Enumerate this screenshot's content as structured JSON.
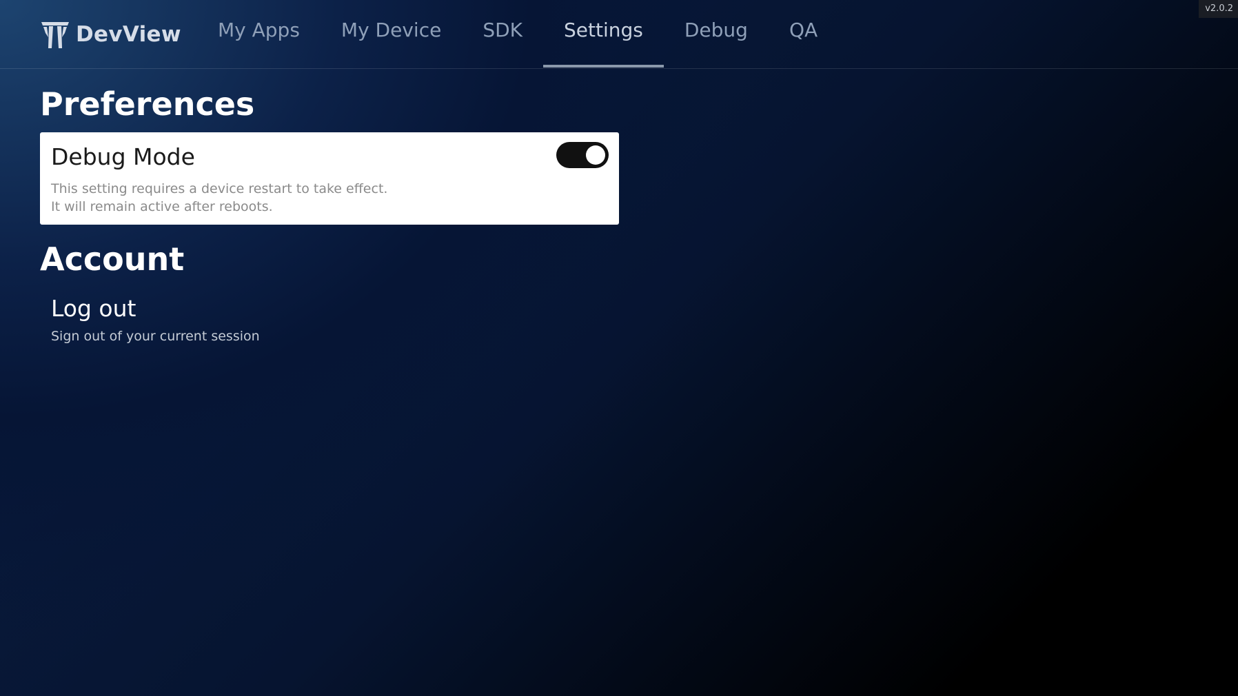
{
  "app": {
    "name": "DevView",
    "version": "v2.0.2"
  },
  "nav": {
    "tabs": [
      {
        "label": "My Apps",
        "active": false
      },
      {
        "label": "My Device",
        "active": false
      },
      {
        "label": "SDK",
        "active": false
      },
      {
        "label": "Settings",
        "active": true
      },
      {
        "label": "Debug",
        "active": false
      },
      {
        "label": "QA",
        "active": false
      }
    ]
  },
  "preferences": {
    "title": "Preferences",
    "debug_mode": {
      "label": "Debug Mode",
      "enabled": true,
      "description_line1": "This setting requires a device restart to take effect.",
      "description_line2": "It will remain active after reboots."
    }
  },
  "account": {
    "title": "Account",
    "logout": {
      "label": "Log out",
      "description": "Sign out of your current session"
    }
  },
  "colors": {
    "background_top": "#1d4470",
    "background_bottom": "#000000",
    "card_bg": "#ffffff",
    "toggle_on": "#111111",
    "tab_active_underline": "#8a98ab"
  },
  "icons": {
    "logo": "devview-logo-icon"
  }
}
